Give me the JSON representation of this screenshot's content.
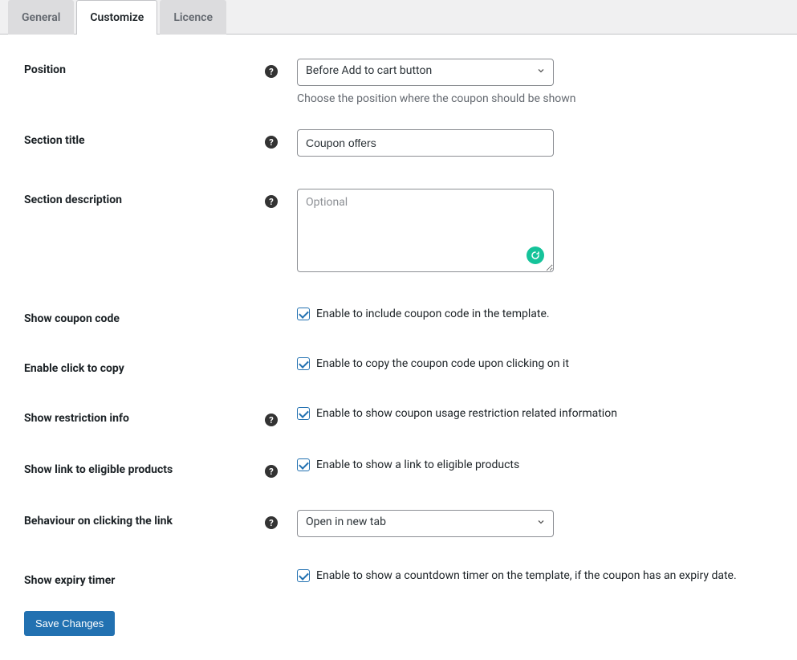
{
  "tabs": {
    "general": "General",
    "customize": "Customize",
    "licence": "Licence"
  },
  "labels": {
    "position": "Position",
    "section_title": "Section title",
    "section_description": "Section description",
    "show_coupon_code": "Show coupon code",
    "enable_click_to_copy": "Enable click to copy",
    "show_restriction_info": "Show restriction info",
    "show_link_eligible": "Show link to eligible products",
    "behaviour_link": "Behaviour on clicking the link",
    "show_expiry_timer": "Show expiry timer"
  },
  "values": {
    "position": "Before Add to cart button",
    "section_title": "Coupon offers",
    "section_description": "",
    "behaviour_link": "Open in new tab"
  },
  "placeholders": {
    "section_description": "Optional"
  },
  "descriptions": {
    "position": "Choose the position where the coupon should be shown"
  },
  "checkbox_text": {
    "show_coupon_code": "Enable to include coupon code in the template.",
    "enable_click_to_copy": "Enable to copy the coupon code upon clicking on it",
    "show_restriction_info": "Enable to show coupon usage restriction related information",
    "show_link_eligible": "Enable to show a link to eligible products",
    "show_expiry_timer": "Enable to show a countdown timer on the template, if the coupon has an expiry date."
  },
  "buttons": {
    "save": "Save Changes"
  },
  "help_glyph": "?"
}
